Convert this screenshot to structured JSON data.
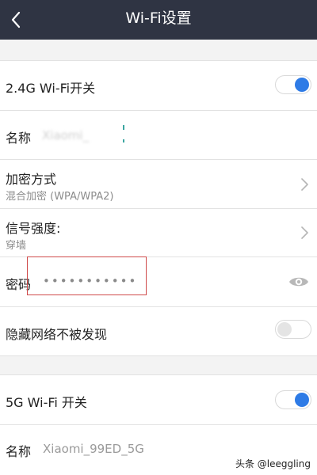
{
  "header": {
    "title": "Wi-Fi设置",
    "back_icon": "chevron-left-icon"
  },
  "wifi_24g": {
    "switch_label": "2.4G Wi-Fi开关",
    "switch_on": true,
    "name_label": "名称",
    "name_value": "Xiaomi_",
    "encryption_label": "加密方式",
    "encryption_value": "混合加密 (WPA/WPA2)",
    "signal_label": "信号强度:",
    "signal_value": "穿墙",
    "password_label": "密码",
    "password_value": "•••••••••••",
    "hidden_label": "隐藏网络不被发现",
    "hidden_on": false
  },
  "wifi_5g": {
    "switch_label": "5G Wi-Fi 开关",
    "switch_on": true,
    "name_label": "名称",
    "name_value": "Xiaomi_99ED_5G"
  },
  "watermark": "头条 @leeggling",
  "colors": {
    "header_bg": "#2f3443",
    "toggle_on": "#2e7be6",
    "highlight_border": "#cf4a4a"
  }
}
